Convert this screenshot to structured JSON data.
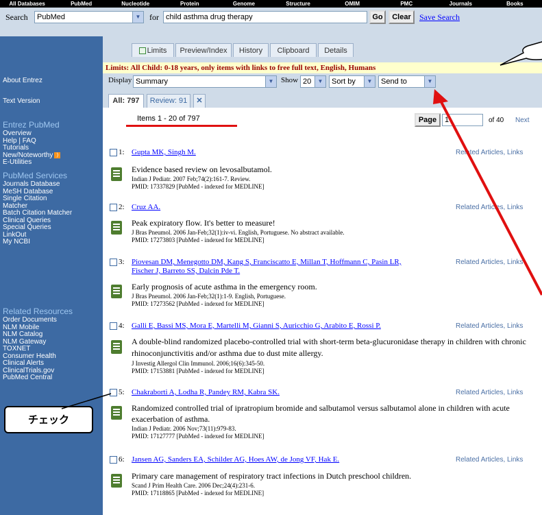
{
  "topbar": [
    "All Databases",
    "PubMed",
    "Nucleotide",
    "Protein",
    "Genome",
    "Structure",
    "OMIM",
    "PMC",
    "Journals",
    "Books"
  ],
  "search": {
    "label": "Search",
    "database": "PubMed",
    "for_label": "for",
    "term": "child asthma drug therapy",
    "go": "Go",
    "clear": "Clear",
    "save_search": "Save Search"
  },
  "sidebar": {
    "about": "About Entrez",
    "text_version": "Text Version",
    "entrez_head": "Entrez PubMed",
    "entrez_items": [
      "Overview",
      "Help | FAQ",
      "Tutorials",
      "New/Noteworthy",
      "E-Utilities"
    ],
    "services_head": "PubMed Services",
    "services_items": [
      "Journals Database",
      "MeSH Database",
      "Single Citation",
      "Matcher",
      "Batch Citation Matcher",
      "Clinical Queries",
      "Special Queries",
      "LinkOut",
      "My NCBI"
    ],
    "resources_head": "Related Resources",
    "resources_items": [
      "Order Documents",
      "NLM Mobile",
      "NLM Catalog",
      "NLM Gateway",
      "TOXNET",
      "Consumer Health",
      "Clinical Alerts",
      "ClinicalTrials.gov",
      "PubMed Central"
    ]
  },
  "tabs": [
    "Limits",
    "Preview/Index",
    "History",
    "Clipboard",
    "Details"
  ],
  "limits_text": "Limits: All Child: 0-18 years, only items with links to free full text, English, Humans",
  "display": {
    "display_label": "Display",
    "display_value": "Summary",
    "show_label": "Show",
    "show_value": "20",
    "sort_value": "Sort by",
    "send_value": "Send to"
  },
  "result_tabs": [
    "All: 797",
    "Review: 91"
  ],
  "items_count": "Items 1 - 20 of 797",
  "page_button": "Page",
  "page_value": "1",
  "of_pages": "of 40",
  "next": "Next",
  "related": "Related Articles, Links",
  "records": [
    {
      "num": "1:",
      "authors": "Gupta MK, Singh M.",
      "authors2": "",
      "title": "Evidence based review on levosalbutamol.",
      "cite1": "Indian J Pediatr. 2007 Feb;74(2):161-7. Review.",
      "cite2": "PMID: 17337829 [PubMed - indexed for MEDLINE]"
    },
    {
      "num": "2:",
      "authors": "Cruz AA.",
      "authors2": "",
      "title": "Peak expiratory flow. It's better to measure!",
      "cite1": "J Bras Pneumol. 2006 Jan-Feb;32(1):iv-vi. English, Portuguese. No abstract available.",
      "cite2": "PMID: 17273803 [PubMed - indexed for MEDLINE]"
    },
    {
      "num": "3:",
      "authors": "Piovesan DM, Menegotto DM, Kang S, Franciscatto E, Millan T, Hoffmann C, Pasin LR,",
      "authors2": "Fischer J, Barreto SS, Dalcin Pde T.",
      "title": "Early prognosis of acute asthma in the emergency room.",
      "cite1": "J Bras Pneumol. 2006 Jan-Feb;32(1):1-9. English, Portuguese.",
      "cite2": "PMID: 17273562 [PubMed - indexed for MEDLINE]"
    },
    {
      "num": "4:",
      "authors": "Galli E, Bassi MS, Mora E, Martelli M, Gianni S, Auricchio G, Arabito E, Rossi P.",
      "authors2": "",
      "title": "A double-blind randomized placebo-controlled trial with short-term beta-glucuronidase therapy in children with chronic rhinoconjunctivitis and/or asthma due to dust mite allergy.",
      "cite1": "J Investig Allergol Clin Immunol. 2006;16(6):345-50.",
      "cite2": "PMID: 17153881 [PubMed - indexed for MEDLINE]"
    },
    {
      "num": "5:",
      "authors": "Chakraborti A, Lodha R, Pandey RM, Kabra SK.",
      "authors2": "",
      "title": "Randomized controlled trial of ipratropium bromide and salbutamol versus salbutamol alone in children with acute exacerbation of asthma.",
      "cite1": "Indian J Pediatr. 2006 Nov;73(11):979-83.",
      "cite2": "PMID: 17127777 [PubMed - indexed for MEDLINE]"
    },
    {
      "num": "6:",
      "authors": "Jansen AG, Sanders EA, Schilder AG, Hoes AW, de Jong VF, Hak E.",
      "authors2": "",
      "title": "Primary care management of respiratory tract infections in Dutch preschool children.",
      "cite1": "Scand J Prim Health Care. 2006 Dec;24(4):231-6.",
      "cite2": "PMID: 17118865 [PubMed - indexed for MEDLINE]"
    }
  ],
  "annotation_check": "チェック"
}
